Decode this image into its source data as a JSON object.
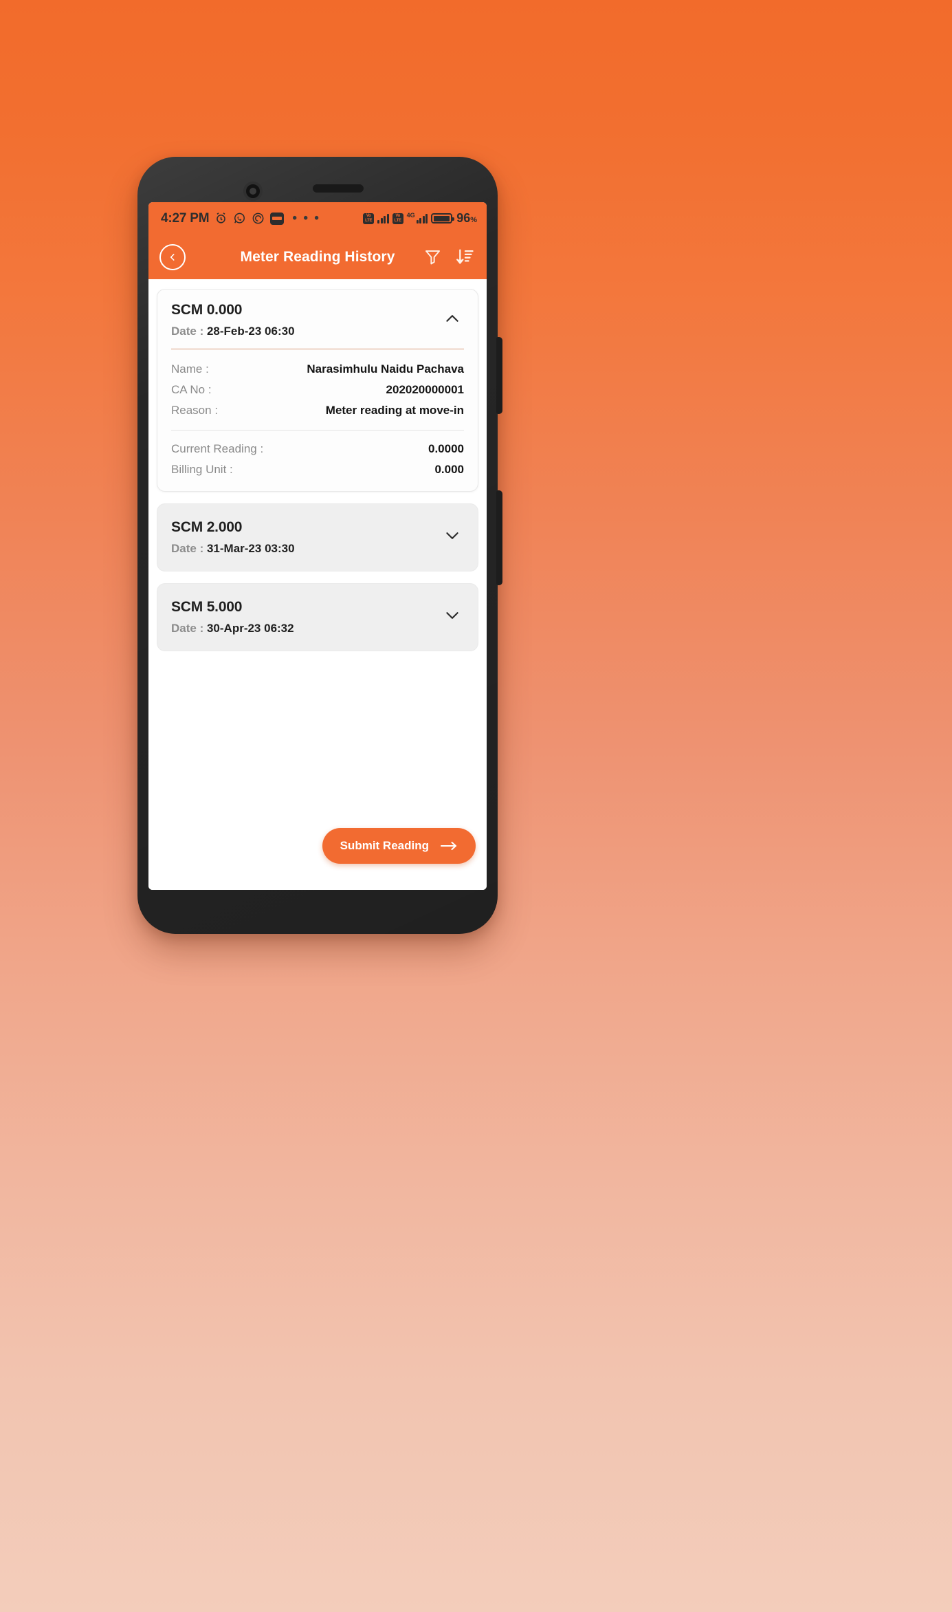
{
  "theme": {
    "accent": "#F26B31",
    "bg_gradient_top": "#F26B2B",
    "bg_gradient_bottom": "#F3CDBB",
    "card_expanded_bg": "#FDFDFD",
    "card_collapsed_bg": "#EFEFEF",
    "separator_accent": "#D99B79"
  },
  "status_bar": {
    "time": "4:27 PM",
    "icons": [
      "alarm-icon",
      "whatsapp-icon",
      "spiral-icon",
      "paytm-icon"
    ],
    "overflow": "• • •",
    "network_label": "4G",
    "volte_line1": "Vo",
    "volte_line2": "LTE",
    "battery_percent": "96",
    "battery_percent_symbol": "%"
  },
  "app_bar": {
    "title": "Meter Reading History",
    "back_label": "‹",
    "actions": [
      {
        "name": "filter-icon",
        "label": "Filter"
      },
      {
        "name": "sort-descending-icon",
        "label": "Sort"
      }
    ]
  },
  "readings": [
    {
      "scm": "SCM 0.000",
      "date_label": "Date : ",
      "date_value": "28-Feb-23 06:30",
      "expanded": true,
      "details_primary": [
        {
          "key": "Name :",
          "value": "Narasimhulu Naidu Pachava"
        },
        {
          "key": "CA No :",
          "value": "202020000001"
        },
        {
          "key": "Reason :",
          "value": "Meter reading at move-in"
        }
      ],
      "details_secondary": [
        {
          "key": "Current Reading :",
          "value": "0.0000"
        },
        {
          "key": "Billing Unit :",
          "value": "0.000"
        }
      ]
    },
    {
      "scm": "SCM 2.000",
      "date_label": "Date : ",
      "date_value": "31-Mar-23 03:30",
      "expanded": false
    },
    {
      "scm": "SCM 5.000",
      "date_label": "Date : ",
      "date_value": "30-Apr-23 06:32",
      "expanded": false
    }
  ],
  "submit": {
    "label": "Submit Reading",
    "arrow": "→"
  }
}
